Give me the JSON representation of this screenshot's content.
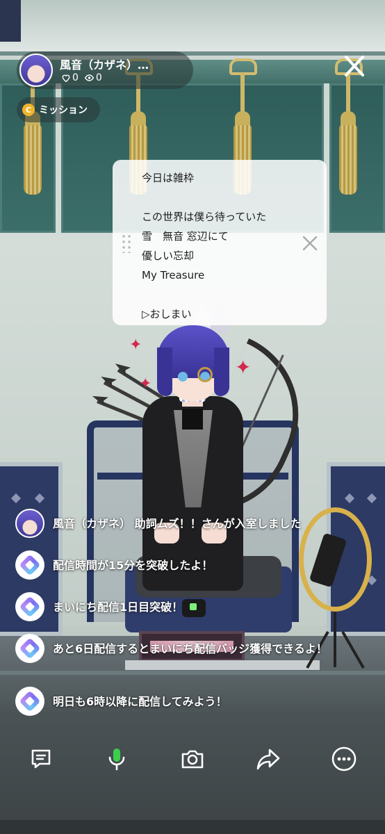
{
  "host": {
    "name": "風音（カザネ）…",
    "likes": "0",
    "viewers": "0"
  },
  "mission": {
    "label": "ミッション",
    "coin_letter": "C"
  },
  "memo": {
    "lines": [
      "今日は雑枠",
      "",
      "この世界は僕ら待っていた",
      "雪　無音 窓辺にて",
      "優しい忘却",
      "My Treasure",
      "",
      "▷おしまい"
    ]
  },
  "chat": {
    "messages": [
      {
        "type": "user",
        "text": "風音（カザネ） 助詞ムズ！！さんが入室しました"
      },
      {
        "type": "system",
        "text": "配信時間が15分を突破したよ！"
      },
      {
        "type": "system",
        "text": "まいにち配信1日目突破！"
      },
      {
        "type": "system",
        "text": "あと6日配信するとまいにち配信バッジ獲得できるよ！"
      },
      {
        "type": "system",
        "text": "明日も6時以降に配信してみよう！"
      }
    ]
  },
  "toolbar": {
    "buttons": [
      "comment-icon",
      "microphone-icon",
      "camera-icon",
      "share-icon",
      "more-icon"
    ]
  },
  "colors": {
    "mic_active": "#3ccf4e",
    "coin": "#f0b429"
  }
}
